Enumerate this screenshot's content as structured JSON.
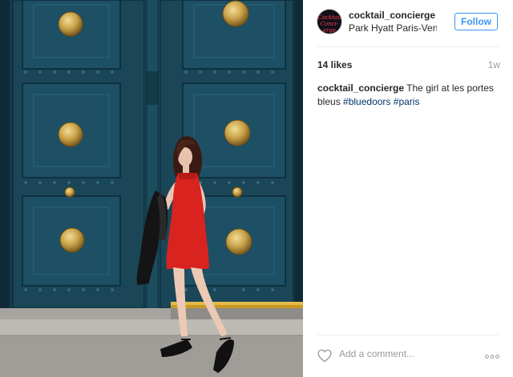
{
  "header": {
    "avatar_alt": "Cocktail Concierge logo",
    "username": "cocktail_concierge",
    "location": "Park Hyatt Paris-Ven...",
    "follow_label": "Follow"
  },
  "stats": {
    "likes": "14 likes",
    "time": "1w"
  },
  "caption": {
    "user": "cocktail_concierge",
    "text": " The girl at les portes bleus ",
    "tags": [
      "#bluedoors",
      "#paris"
    ]
  },
  "comment": {
    "placeholder": "Add a comment..."
  },
  "colors": {
    "door_blue": "#1f4a5c",
    "follow_blue": "#3897f0",
    "hashtag_blue": "#003569",
    "dress_red": "#d8231f"
  },
  "icons": [
    "heart-icon",
    "more-options-icon"
  ]
}
